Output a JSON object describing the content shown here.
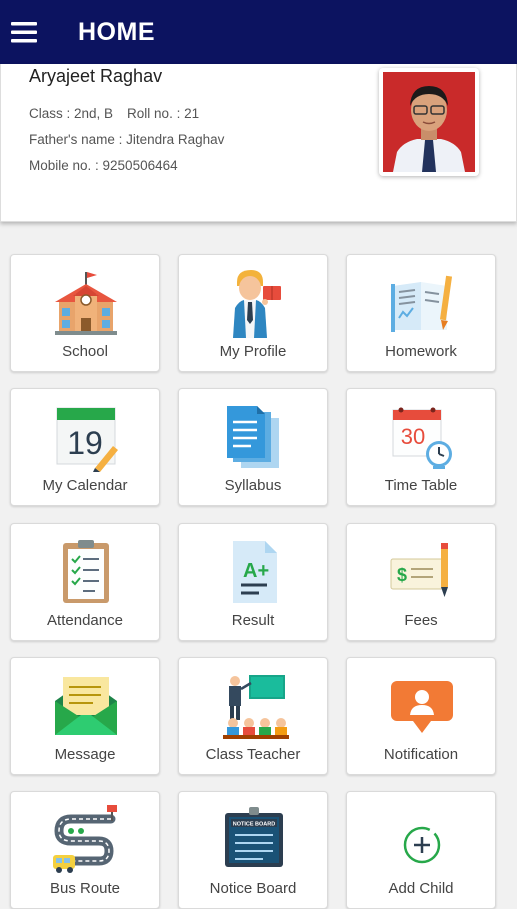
{
  "app_bar": {
    "title": "HOME"
  },
  "student": {
    "name": "Aryajeet Raghav",
    "class_text": "Class : 2nd, B",
    "roll_text": "Roll no. : 21",
    "father_text": "Father's name : Jitendra Raghav",
    "mobile_text": "Mobile no. : 9250506464"
  },
  "tiles": [
    {
      "label": "School",
      "icon": "school-icon"
    },
    {
      "label": "My Profile",
      "icon": "teacher-profile-icon"
    },
    {
      "label": "Homework",
      "icon": "book-pencil-icon"
    },
    {
      "label": "My Calendar",
      "icon": "calendar-icon",
      "calendar_day": "19"
    },
    {
      "label": "Syllabus",
      "icon": "documents-icon"
    },
    {
      "label": "Time Table",
      "icon": "calendar-clock-icon",
      "calendar_day": "30"
    },
    {
      "label": "Attendance",
      "icon": "clipboard-checklist-icon"
    },
    {
      "label": "Result",
      "icon": "grade-sheet-icon",
      "grade": "A+"
    },
    {
      "label": "Fees",
      "icon": "cheque-pen-icon",
      "currency": "$"
    },
    {
      "label": "Message",
      "icon": "envelope-icon"
    },
    {
      "label": "Class Teacher",
      "icon": "classroom-icon"
    },
    {
      "label": "Notification",
      "icon": "notification-bubble-icon"
    },
    {
      "label": "Bus Route",
      "icon": "bus-route-icon"
    },
    {
      "label": "Notice Board",
      "icon": "notice-board-icon",
      "board_text": "NOTICE BOARD"
    },
    {
      "label": "Add Child",
      "icon": "add-circle-icon"
    }
  ],
  "colors": {
    "app_bar": "#0c1360",
    "accent_green": "#27a84a",
    "accent_orange": "#f27a35"
  }
}
